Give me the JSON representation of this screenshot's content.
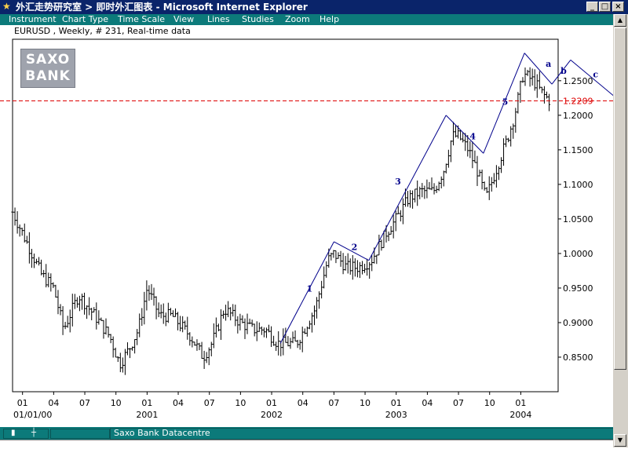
{
  "window": {
    "title": "外汇走势研究室 > 即时外汇图表 - Microsoft Internet Explorer",
    "minimize": "_",
    "maximize": "□",
    "close": "×"
  },
  "menu": {
    "items": [
      "Instrument",
      "Chart Type",
      "Time Scale",
      "View",
      "Lines",
      "Studies",
      "Zoom",
      "Help"
    ]
  },
  "chart_header": {
    "subtitle": "EURUSD , Weekly, # 231, Real-time data"
  },
  "logo": {
    "line1": "SAXO",
    "line2": "BANK"
  },
  "status": {
    "text": "Saxo Bank Datacentre"
  },
  "colors": {
    "menu_bg": "#0c7a7a",
    "title_bg": "#0a246a",
    "price_line": "#dd0000",
    "wave_line": "#00008b",
    "bars": "#000000"
  },
  "chart_data": {
    "type": "ohlc-bar",
    "instrument": "EURUSD",
    "timeframe": "Weekly",
    "ylim": [
      0.8,
      1.31
    ],
    "y_ticks": [
      0.85,
      0.9,
      0.95,
      1.0,
      1.05,
      1.1,
      1.15,
      1.2,
      1.25
    ],
    "y_tick_labels": [
      "0.8500",
      "0.9000",
      "0.9500",
      "1.0000",
      "1.0500",
      "1.1000",
      "1.1500",
      "1.2000",
      "1.2500"
    ],
    "current_price_line": 1.2209,
    "current_price_label": "1.2209",
    "x_range": [
      1999.92,
      2004.3
    ],
    "x_ticks": [
      {
        "t": 2000.0,
        "label": "01"
      },
      {
        "t": 2000.25,
        "label": "04"
      },
      {
        "t": 2000.5,
        "label": "07"
      },
      {
        "t": 2000.75,
        "label": "10"
      },
      {
        "t": 2001.0,
        "label": "01"
      },
      {
        "t": 2001.25,
        "label": "04"
      },
      {
        "t": 2001.5,
        "label": "07"
      },
      {
        "t": 2001.75,
        "label": "10"
      },
      {
        "t": 2002.0,
        "label": "01"
      },
      {
        "t": 2002.25,
        "label": "04"
      },
      {
        "t": 2002.5,
        "label": "07"
      },
      {
        "t": 2002.75,
        "label": "10"
      },
      {
        "t": 2003.0,
        "label": "01"
      },
      {
        "t": 2003.25,
        "label": "04"
      },
      {
        "t": 2003.5,
        "label": "07"
      },
      {
        "t": 2003.75,
        "label": "10"
      },
      {
        "t": 2004.0,
        "label": "01"
      }
    ],
    "x_year_labels": [
      {
        "t": 2000.0,
        "label": "01/01/00"
      },
      {
        "t": 2001.0,
        "label": "2001"
      },
      {
        "t": 2002.0,
        "label": "2002"
      },
      {
        "t": 2003.0,
        "label": "2003"
      },
      {
        "t": 2004.0,
        "label": "2004"
      }
    ],
    "price_path": [
      [
        1999.92,
        1.06
      ],
      [
        2000.05,
        1.01
      ],
      [
        2000.15,
        0.97
      ],
      [
        2000.25,
        0.95
      ],
      [
        2000.33,
        0.89
      ],
      [
        2000.45,
        0.94
      ],
      [
        2000.58,
        0.91
      ],
      [
        2000.7,
        0.88
      ],
      [
        2000.78,
        0.84
      ],
      [
        2000.85,
        0.86
      ],
      [
        2000.93,
        0.89
      ],
      [
        2001.0,
        0.95
      ],
      [
        2001.1,
        0.91
      ],
      [
        2001.2,
        0.91
      ],
      [
        2001.35,
        0.88
      ],
      [
        2001.45,
        0.85
      ],
      [
        2001.52,
        0.87
      ],
      [
        2001.62,
        0.92
      ],
      [
        2001.75,
        0.9
      ],
      [
        2001.85,
        0.89
      ],
      [
        2001.95,
        0.89
      ],
      [
        2002.05,
        0.87
      ],
      [
        2002.2,
        0.87
      ],
      [
        2002.35,
        0.92
      ],
      [
        2002.45,
        0.99
      ],
      [
        2002.5,
        1.0
      ],
      [
        2002.6,
        0.98
      ],
      [
        2002.7,
        0.98
      ],
      [
        2002.8,
        0.99
      ],
      [
        2002.92,
        1.03
      ],
      [
        2003.0,
        1.05
      ],
      [
        2003.1,
        1.08
      ],
      [
        2003.2,
        1.09
      ],
      [
        2003.3,
        1.09
      ],
      [
        2003.38,
        1.12
      ],
      [
        2003.45,
        1.17
      ],
      [
        2003.5,
        1.17
      ],
      [
        2003.58,
        1.15
      ],
      [
        2003.65,
        1.12
      ],
      [
        2003.72,
        1.08
      ],
      [
        2003.8,
        1.12
      ],
      [
        2003.9,
        1.17
      ],
      [
        2003.95,
        1.2
      ],
      [
        2004.02,
        1.26
      ],
      [
        2004.1,
        1.25
      ],
      [
        2004.18,
        1.23
      ],
      [
        2004.24,
        1.22
      ]
    ],
    "wave_lines": [
      [
        [
          2002.07,
          0.87
        ],
        [
          2002.5,
          1.017
        ]
      ],
      [
        [
          2002.5,
          1.017
        ],
        [
          2002.78,
          0.99
        ]
      ],
      [
        [
          2002.78,
          0.99
        ],
        [
          2003.4,
          1.2
        ]
      ],
      [
        [
          2003.4,
          1.2
        ],
        [
          2003.7,
          1.145
        ]
      ],
      [
        [
          2003.7,
          1.145
        ],
        [
          2004.03,
          1.29
        ]
      ],
      [
        [
          2004.03,
          1.29
        ],
        [
          2004.25,
          1.245
        ]
      ],
      [
        [
          2004.25,
          1.245
        ],
        [
          2004.4,
          1.28
        ]
      ],
      [
        [
          2004.4,
          1.28
        ],
        [
          2004.8,
          1.22
        ]
      ]
    ],
    "wave_labels": [
      {
        "t": 2002.28,
        "y": 0.945,
        "label": "1"
      },
      {
        "t": 2002.64,
        "y": 1.005,
        "label": "2"
      },
      {
        "t": 2002.99,
        "y": 1.1,
        "label": "3"
      },
      {
        "t": 2003.59,
        "y": 1.165,
        "label": "4"
      },
      {
        "t": 2003.85,
        "y": 1.215,
        "label": "5"
      },
      {
        "t": 2004.2,
        "y": 1.27,
        "label": "a"
      },
      {
        "t": 2004.32,
        "y": 1.26,
        "label": "b"
      },
      {
        "t": 2004.58,
        "y": 1.255,
        "label": "c"
      }
    ]
  }
}
